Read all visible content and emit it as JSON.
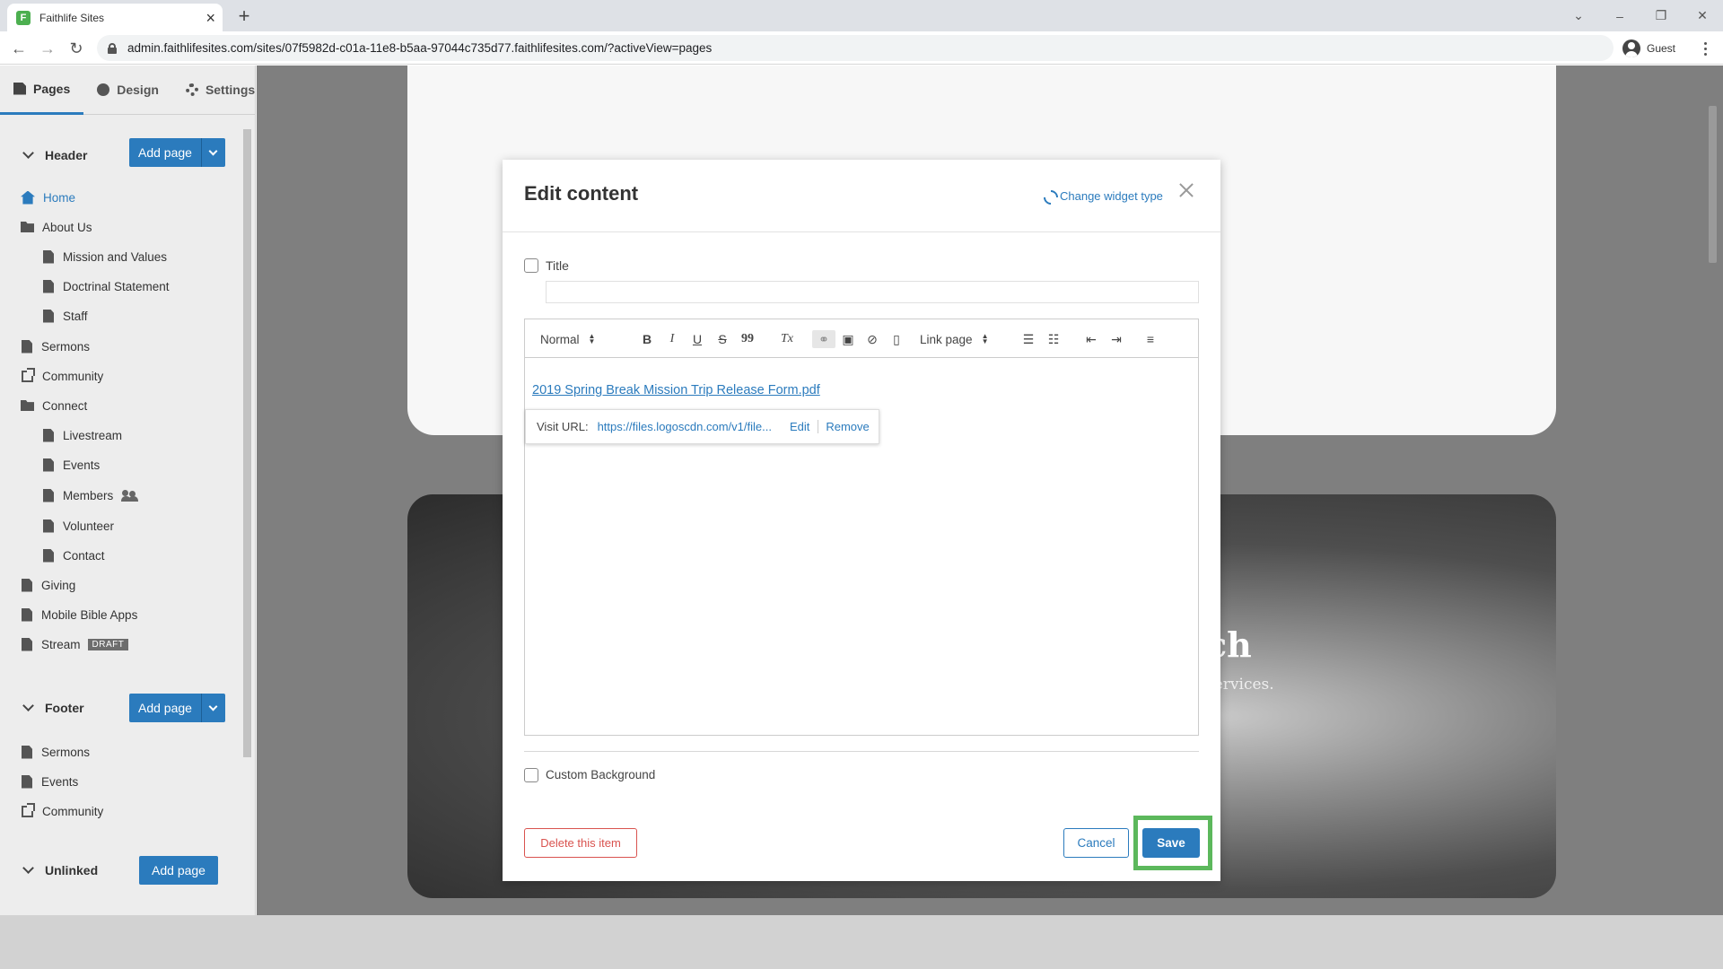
{
  "browser": {
    "tab_title": "Faithlife Sites",
    "tab_favicon": "faithlife-icon",
    "new_tab_label": "+",
    "url": "admin.faithlifesites.com/sites/07f5982d-c01a-11e8-b5aa-97044c735d77.faithlifesites.com/?activeView=pages",
    "profile_label": "Guest"
  },
  "sidebar": {
    "tabs": [
      {
        "label": "Pages",
        "icon": "page-icon"
      },
      {
        "label": "Design",
        "icon": "palette-icon"
      },
      {
        "label": "Settings",
        "icon": "gear-icon"
      }
    ],
    "header_section": {
      "title": "Header",
      "add_label": "Add page",
      "items": [
        {
          "label": "Home",
          "icon": "home-icon"
        },
        {
          "label": "About Us",
          "icon": "folder-icon"
        },
        {
          "label": "Mission and Values",
          "icon": "page-icon"
        },
        {
          "label": "Doctrinal Statement",
          "icon": "page-icon"
        },
        {
          "label": "Staff",
          "icon": "page-icon"
        },
        {
          "label": "Sermons",
          "icon": "page-icon"
        },
        {
          "label": "Community",
          "icon": "external-link-icon"
        },
        {
          "label": "Connect",
          "icon": "folder-icon"
        },
        {
          "label": "Livestream",
          "icon": "page-icon"
        },
        {
          "label": "Events",
          "icon": "page-icon"
        },
        {
          "label": "Members",
          "icon": "page-icon"
        },
        {
          "label": "Volunteer",
          "icon": "page-icon"
        },
        {
          "label": "Contact",
          "icon": "page-icon"
        },
        {
          "label": "Giving",
          "icon": "page-icon"
        },
        {
          "label": "Mobile Bible Apps",
          "icon": "page-icon"
        },
        {
          "label": "Stream",
          "icon": "page-icon",
          "badge": "DRAFT"
        }
      ]
    },
    "footer_section": {
      "title": "Footer",
      "add_label": "Add page",
      "items": [
        {
          "label": "Sermons",
          "icon": "page-icon"
        },
        {
          "label": "Events",
          "icon": "page-icon"
        },
        {
          "label": "Community",
          "icon": "external-link-icon"
        }
      ]
    },
    "unlinked_section": {
      "title": "Unlinked",
      "add_label": "Add page"
    }
  },
  "preview": {
    "hero_title_fragment": "ch",
    "hero_sub_fragment": "services."
  },
  "modal": {
    "title": "Edit content",
    "change_widget_label": "Change widget type",
    "title_checkbox_label": "Title",
    "title_input_value": "",
    "toolbar": {
      "format_select": "Normal",
      "link_select": "Link page",
      "bold": "B",
      "italic": "I",
      "underline": "U",
      "strike": "S",
      "quote": "99",
      "clear_format": "Tx"
    },
    "content_link_text": "2019 Spring Break Mission Trip Release Form.pdf",
    "link_tooltip": {
      "label": "Visit URL:",
      "url": "https://files.logoscdn.com/v1/file...",
      "edit_label": "Edit",
      "remove_label": "Remove"
    },
    "custom_background_label": "Custom Background",
    "delete_label": "Delete this item",
    "cancel_label": "Cancel",
    "save_label": "Save"
  },
  "colors": {
    "accent": "#2b7bbd",
    "danger": "#d9534f",
    "highlight": "#5cb85c"
  }
}
